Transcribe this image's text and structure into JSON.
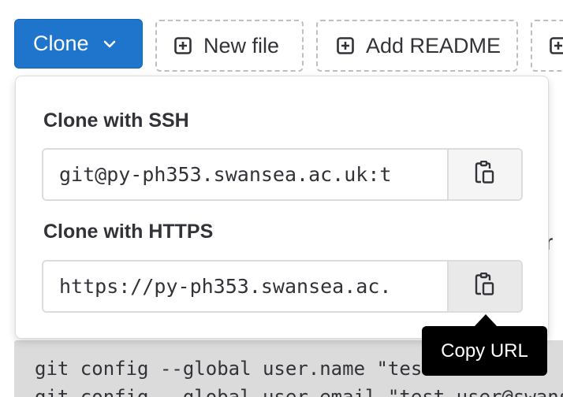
{
  "toolbar": {
    "clone_label": "Clone",
    "new_file_label": "New file",
    "add_readme_label": "Add README"
  },
  "clone_dropdown": {
    "ssh": {
      "label": "Clone with SSH",
      "value": "git@py-ph353.swansea.ac.uk:t"
    },
    "https": {
      "label": "Clone with HTTPS",
      "value": "https://py-ph353.swansea.ac."
    },
    "copy_icon": "clipboard-icon"
  },
  "tooltip": {
    "text": "Copy URL"
  },
  "background": {
    "right_char": "r",
    "code_lines": [
      "git config --global user.name \"test user\"",
      "git config --global user.email \"test.user@swansea.ac.uk\""
    ]
  },
  "colors": {
    "primary": "#1f75cb",
    "tooltip_bg": "#000000",
    "code_bg": "#dbdbdb"
  }
}
